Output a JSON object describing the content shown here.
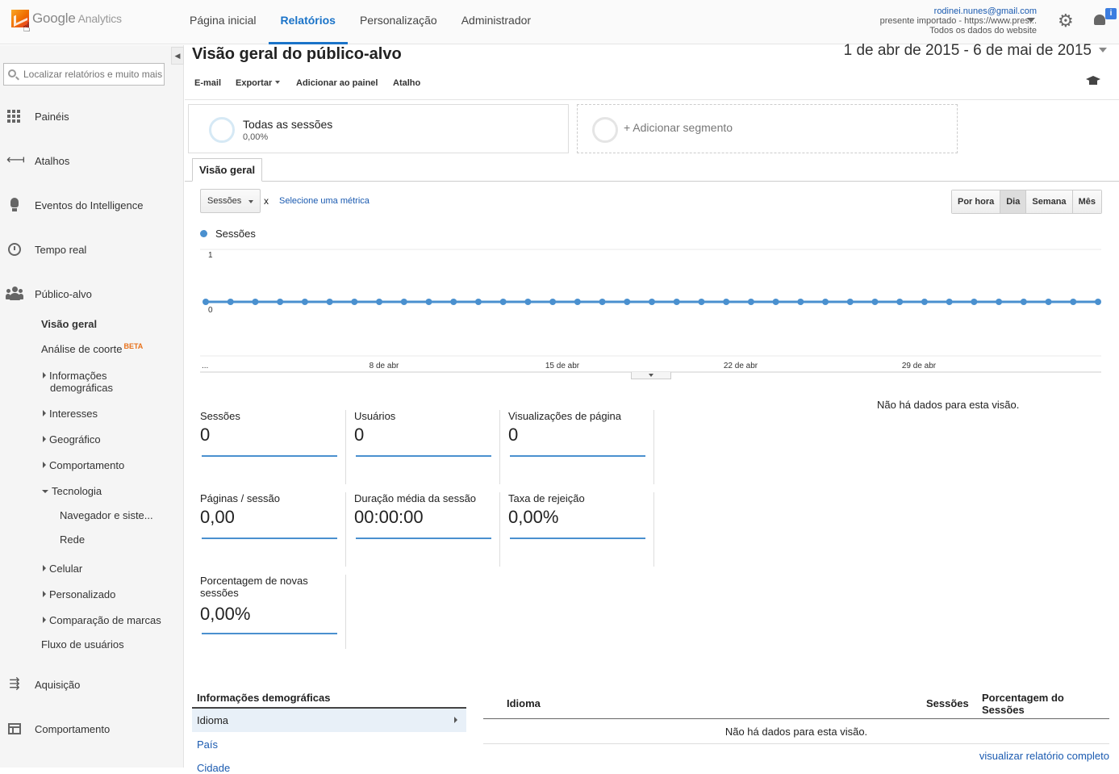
{
  "app": {
    "logo_text": "Google",
    "logo_sub": "Analytics"
  },
  "topnav": [
    {
      "label": "Página inicial",
      "active": false
    },
    {
      "label": "Relatórios",
      "active": true
    },
    {
      "label": "Personalização",
      "active": false
    },
    {
      "label": "Administrador",
      "active": false
    }
  ],
  "account": {
    "email": "rodinei.nunes@gmail.com",
    "property": "presente importado - https://www.pres...",
    "view": "Todos os dados do website",
    "notification_badge": "i"
  },
  "sidebar": {
    "search_placeholder": "Localizar relatórios e muito mais",
    "items": [
      {
        "label": "Painéis",
        "icon": "dashboard-grid-icon"
      },
      {
        "label": "Atalhos",
        "icon": "shortcut-arrow-icon"
      },
      {
        "label": "Eventos do Intelligence",
        "icon": "lightbulb-icon"
      },
      {
        "label": "Tempo real",
        "icon": "clock-icon"
      },
      {
        "label": "Público-alvo",
        "icon": "people-icon"
      },
      {
        "label": "Aquisição",
        "icon": "acquisition-arrows-icon"
      },
      {
        "label": "Comportamento",
        "icon": "behavior-layout-icon"
      }
    ],
    "audience_sub": {
      "overview": "Visão geral",
      "cohort": "Análise de coorte",
      "cohort_badge": "BETA",
      "demographics_1": "Informações",
      "demographics_2": "demográficas",
      "interests": "Interesses",
      "geo": "Geográfico",
      "behavior": "Comportamento",
      "technology": "Tecnologia",
      "browser": "Navegador e siste...",
      "network": "Rede",
      "mobile": "Celular",
      "custom": "Personalizado",
      "benchmarking": "Comparação de marcas",
      "users_flow": "Fluxo de usuários"
    }
  },
  "main": {
    "title": "Visão geral do público-alvo",
    "date_range": "1 de abr de 2015 - 6 de mai de 2015",
    "actions": {
      "email": "E-mail",
      "export": "Exportar",
      "add_dashboard": "Adicionar ao painel",
      "shortcut": "Atalho"
    },
    "segments": {
      "active_title": "Todas as sessões",
      "active_pct": "0,00%",
      "add_label": "+ Adicionar segmento"
    },
    "tab": "Visão geral",
    "metric_select": "Sessões",
    "metric_x": "x",
    "metric_link": "Selecione uma métrica",
    "periods": [
      {
        "label": "Por hora",
        "on": false
      },
      {
        "label": "Dia",
        "on": true
      },
      {
        "label": "Semana",
        "on": false
      },
      {
        "label": "Mês",
        "on": false
      }
    ],
    "no_data": "Não há dados para esta visão.",
    "scorecards": [
      {
        "label": "Sessões",
        "value": "0"
      },
      {
        "label": "Usuários",
        "value": "0"
      },
      {
        "label": "Visualizações de página",
        "value": "0"
      },
      {
        "label": "Páginas / sessão",
        "value": "0,00"
      },
      {
        "label": "Duração média da sessão",
        "value": "00:00:00"
      },
      {
        "label": "Taxa de rejeição",
        "value": "0,00%"
      },
      {
        "label": "Porcentagem de novas sessões",
        "value": "0,00%"
      }
    ],
    "demographics": {
      "title": "Informações demográficas",
      "active": "Idioma",
      "links": [
        "País",
        "Cidade"
      ]
    },
    "table": {
      "col1": "Idioma",
      "col2": "Sessões",
      "col3": "Porcentagem do Sessões",
      "empty": "Não há dados para esta visão.",
      "full_report": "visualizar relatório completo"
    }
  },
  "chart_data": {
    "type": "line",
    "series": [
      {
        "name": "Sessões",
        "values": [
          0,
          0,
          0,
          0,
          0,
          0,
          0,
          0,
          0,
          0,
          0,
          0,
          0,
          0,
          0,
          0,
          0,
          0,
          0,
          0,
          0,
          0,
          0,
          0,
          0,
          0,
          0,
          0,
          0,
          0,
          0,
          0,
          0,
          0,
          0,
          0,
          0
        ]
      }
    ],
    "x_tick_labels": [
      "...",
      "8 de abr",
      "15 de abr",
      "22 de abr",
      "29 de abr"
    ],
    "y_tick_labels": [
      "1",
      "0"
    ],
    "ylim": [
      0,
      1
    ],
    "color": "#4a90cf"
  }
}
